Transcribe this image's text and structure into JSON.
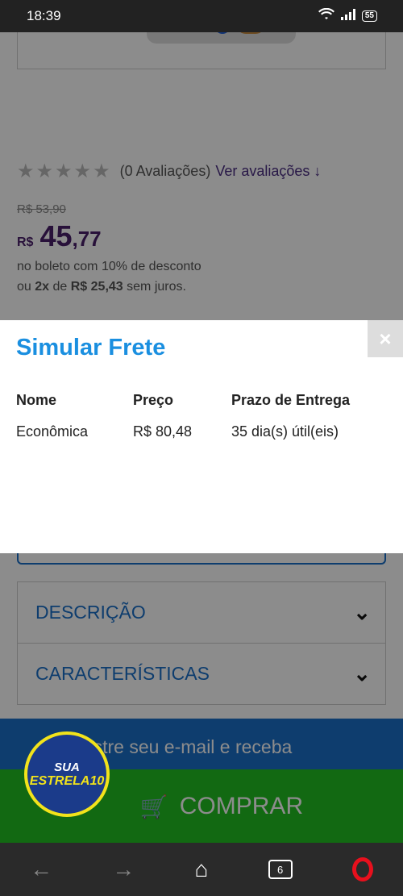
{
  "status_bar": {
    "time": "18:39",
    "battery": "55"
  },
  "product": {
    "rating_count": "(0 Avaliações)",
    "rating_link": "Ver avaliações",
    "old_price": "R$ 53,90",
    "price_currency": "R$",
    "price_int": "45",
    "price_dec": ",77",
    "boleto_info": "no boleto com 10% de desconto",
    "installments_prefix": "ou",
    "installments_count": "2x",
    "installments_mid": "de",
    "installments_value": "R$ 25,43",
    "installments_suffix": "sem juros."
  },
  "modal": {
    "title": "Simular Frete",
    "close": "×",
    "headers": [
      "Nome",
      "Preço",
      "Prazo de Entrega"
    ],
    "rows": [
      [
        "Econômica",
        "R$ 80,48",
        "35 dia(s) útil(eis)"
      ]
    ]
  },
  "accordions": [
    "DESCRIÇÃO",
    "CARACTERÍSTICAS"
  ],
  "newsletter_text": "dastre seu e-mail e receba",
  "buy_label": "COMPRAR",
  "badge": {
    "line1": "SUA",
    "line2a": "ESTRELA",
    "line2b": "10"
  },
  "nav": {
    "tabs_count": "6"
  },
  "colors": {
    "accent_blue": "#1a8fe0",
    "buy_green": "#22c022",
    "price_purple": "#4a1f6b"
  }
}
